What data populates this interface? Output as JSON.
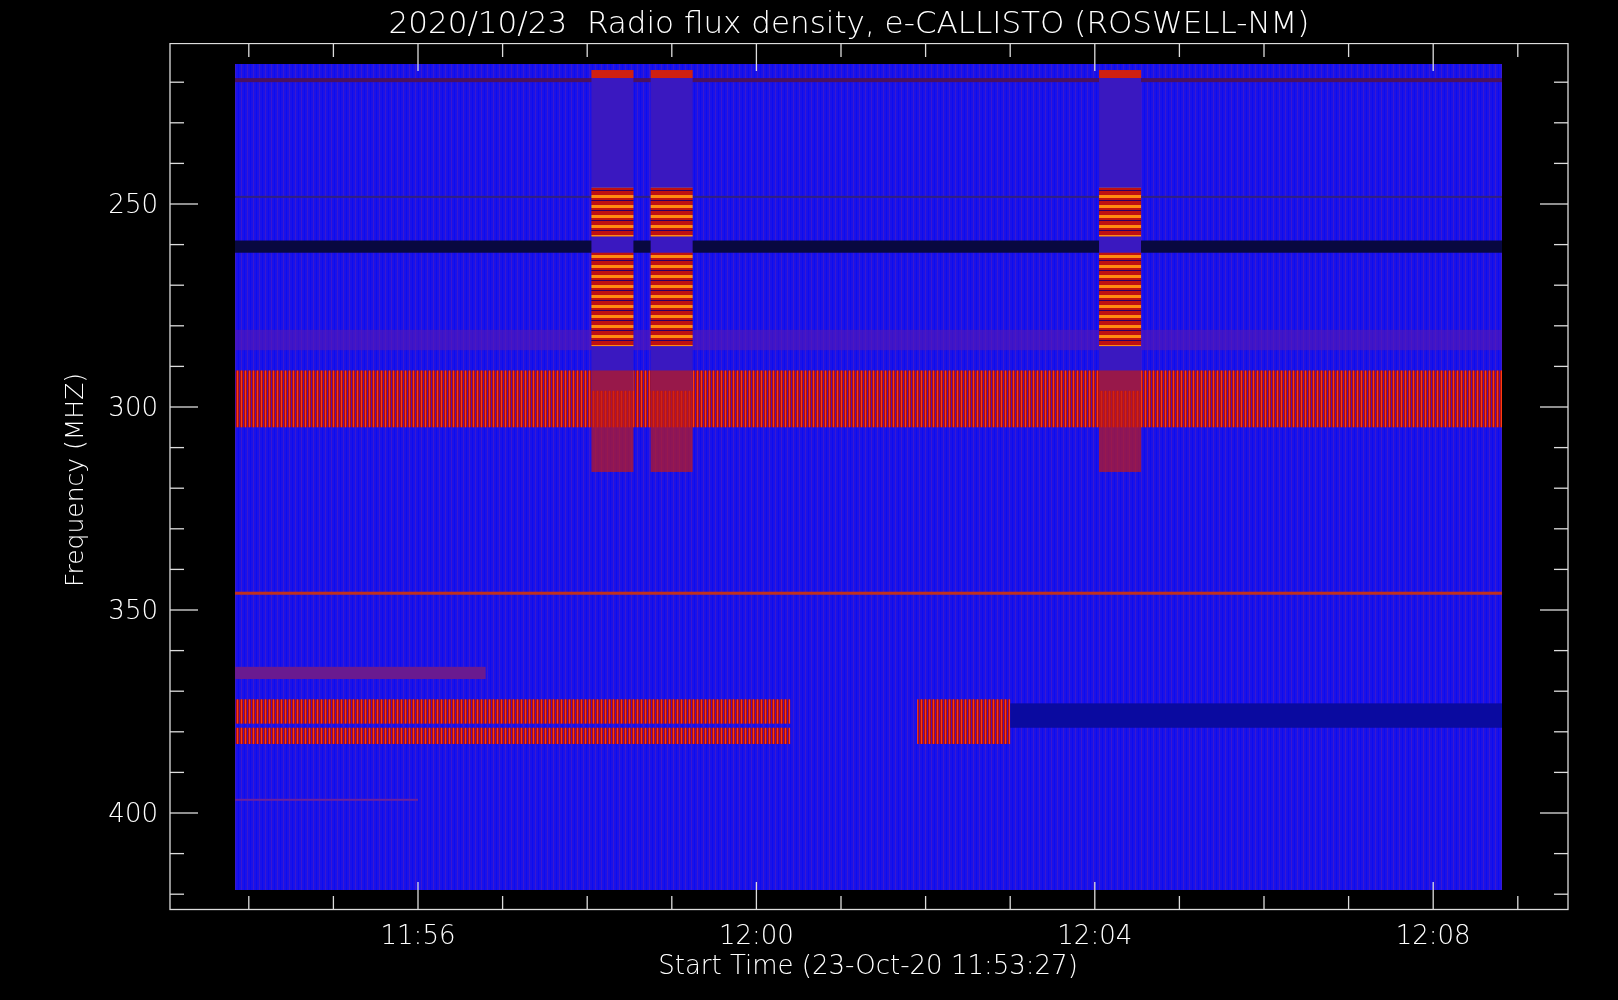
{
  "title": "2020/10/23  Radio flux density, e-CALLISTO (ROSWELL-NM)",
  "y_axis": {
    "title": "Frequency (MHZ)",
    "tick_labels": [
      "250",
      "300",
      "350",
      "400"
    ]
  },
  "x_axis": {
    "title": "Start Time (23-Oct-20 11:53:27)",
    "tick_labels": [
      "11:56",
      "12:00",
      "12:04",
      "12:08"
    ]
  }
}
